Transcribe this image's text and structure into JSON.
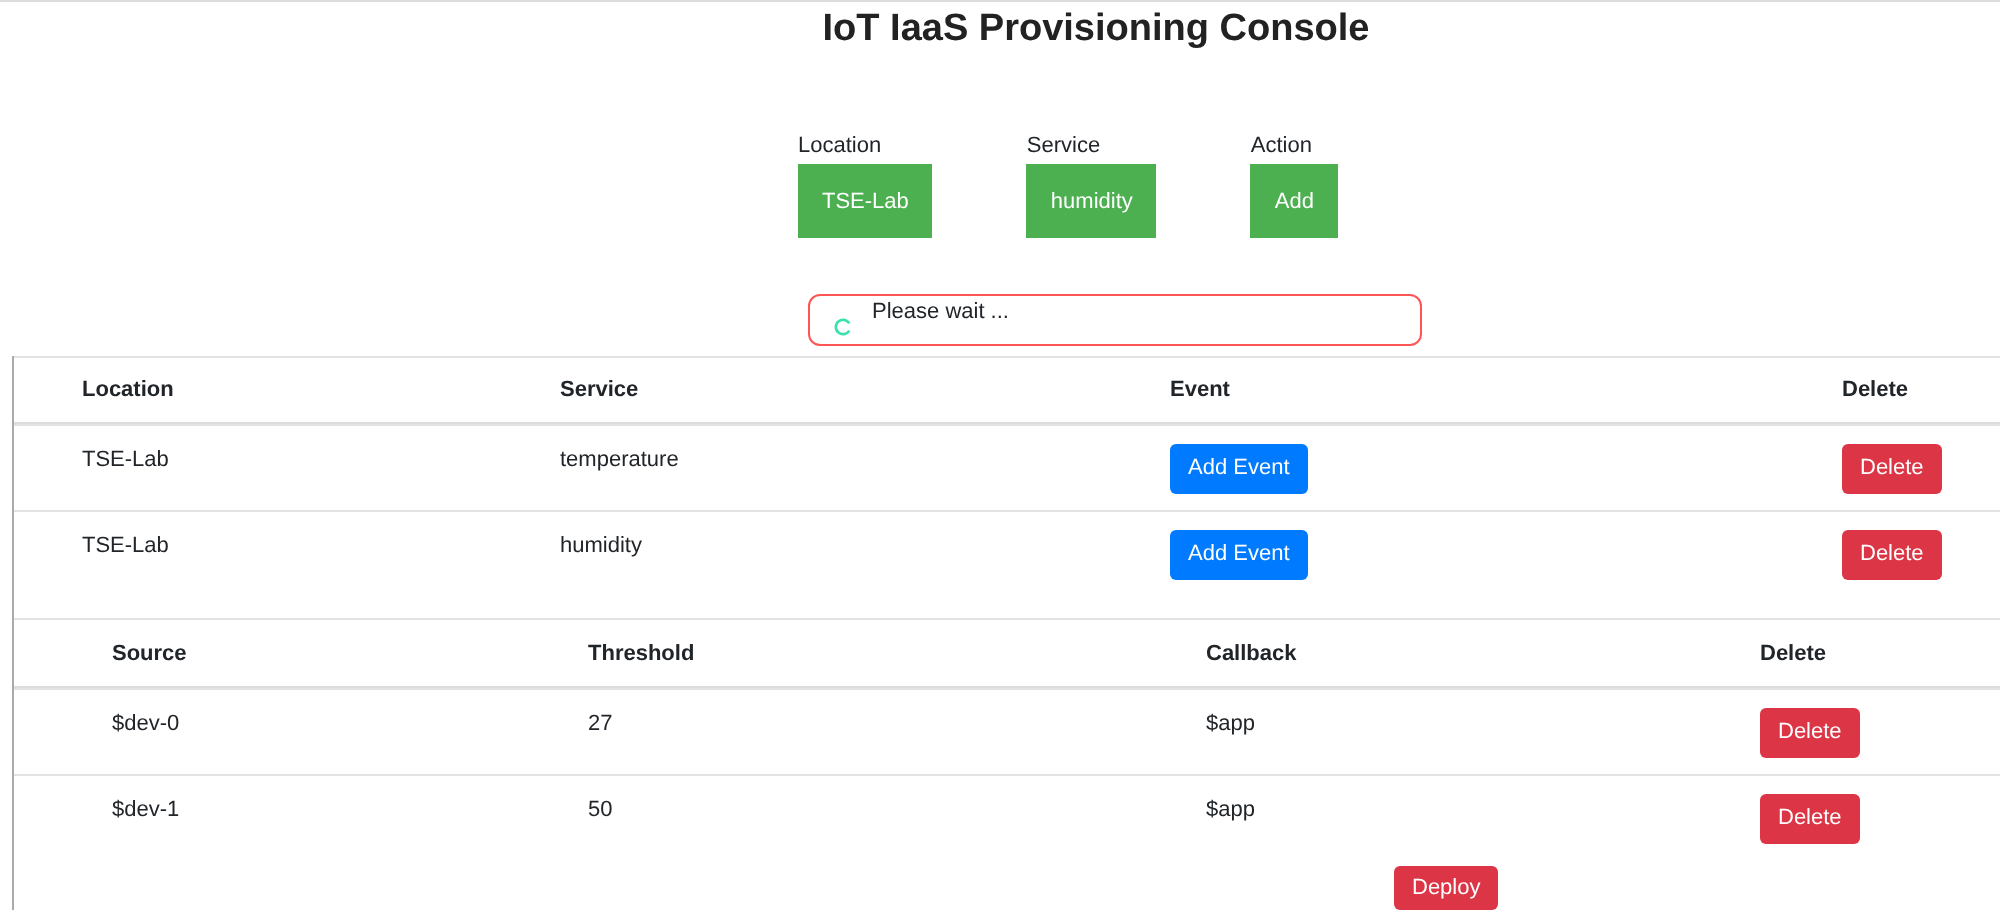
{
  "title": "IoT IaaS Provisioning Console",
  "controls": [
    {
      "label": "Location",
      "value": "TSE-Lab"
    },
    {
      "label": "Service",
      "value": "humidity"
    },
    {
      "label": "Action",
      "value": "Add"
    }
  ],
  "status": {
    "text": "Please wait ...",
    "loading": true
  },
  "services_table": {
    "columns": [
      "Location",
      "Service",
      "Event",
      "Delete"
    ],
    "rows": [
      {
        "location": "TSE-Lab",
        "service": "temperature",
        "event_button": "Add Event",
        "delete_button": "Delete"
      },
      {
        "location": "TSE-Lab",
        "service": "humidity",
        "event_button": "Add Event",
        "delete_button": "Delete"
      }
    ]
  },
  "events_table": {
    "columns": [
      "Source",
      "Threshold",
      "Callback",
      "Delete"
    ],
    "rows": [
      {
        "source": "$dev-0",
        "threshold": "27",
        "callback": "$app",
        "delete_button": "Delete"
      },
      {
        "source": "$dev-1",
        "threshold": "50",
        "callback": "$app",
        "delete_button": "Delete"
      }
    ]
  },
  "deploy_button": "Deploy"
}
